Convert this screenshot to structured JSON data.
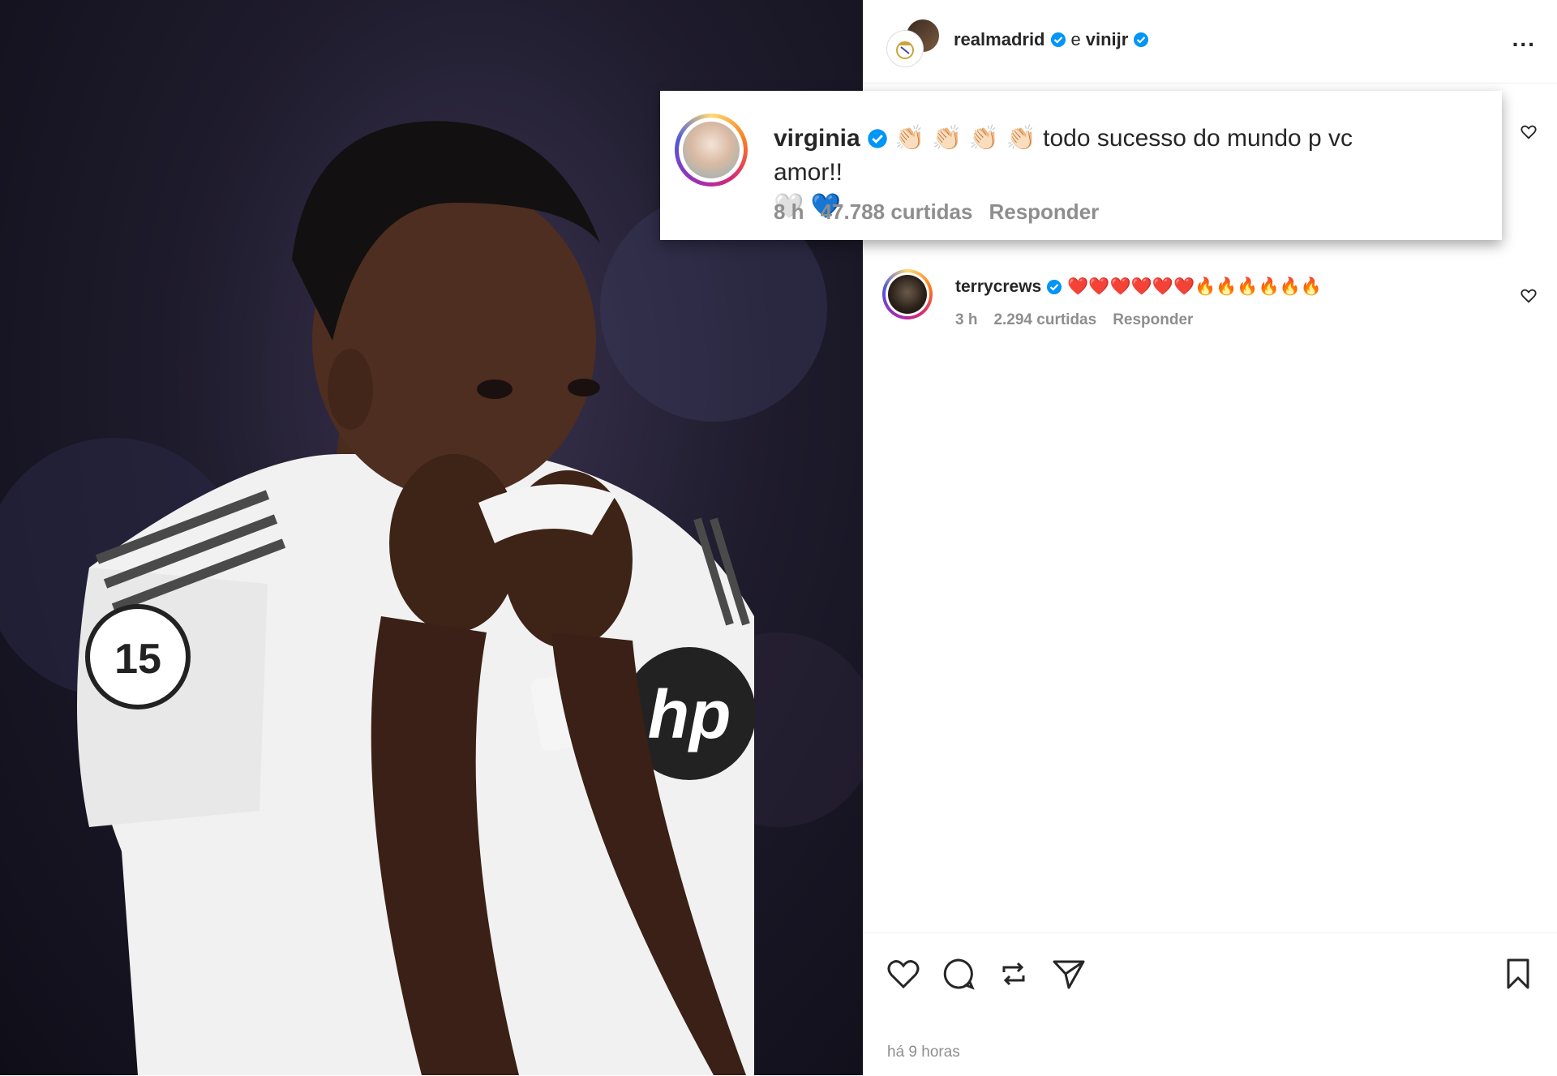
{
  "post": {
    "owner_primary": "realmadrid",
    "owner_separator": "e",
    "owner_secondary": "vinijr",
    "more_label": "...",
    "timestamp": "há 9 horas"
  },
  "highlighted_comment": {
    "username": "virginia",
    "emojis_lead": "👏🏻 👏🏻 👏🏻 👏🏻",
    "text": "todo sucesso do mundo p vc amor!!",
    "emojis_tail": "🤍 💙",
    "time": "8 h",
    "likes": "47.788 curtidas",
    "reply": "Responder"
  },
  "comments": [
    {
      "username": "terrycrews",
      "emojis": "❤️❤️❤️❤️❤️❤️🔥🔥🔥🔥🔥🔥",
      "time": "3 h",
      "likes": "2.294 curtidas",
      "reply": "Responder"
    }
  ],
  "icons": {
    "verified": "verified-badge-icon",
    "like": "heart-icon",
    "comment": "comment-bubble-icon",
    "repost": "repost-icon",
    "share": "paper-plane-icon",
    "save": "bookmark-icon"
  },
  "colors": {
    "verified_blue": "#0095f6",
    "text_primary": "#262626",
    "text_secondary": "#8e8e8e"
  }
}
